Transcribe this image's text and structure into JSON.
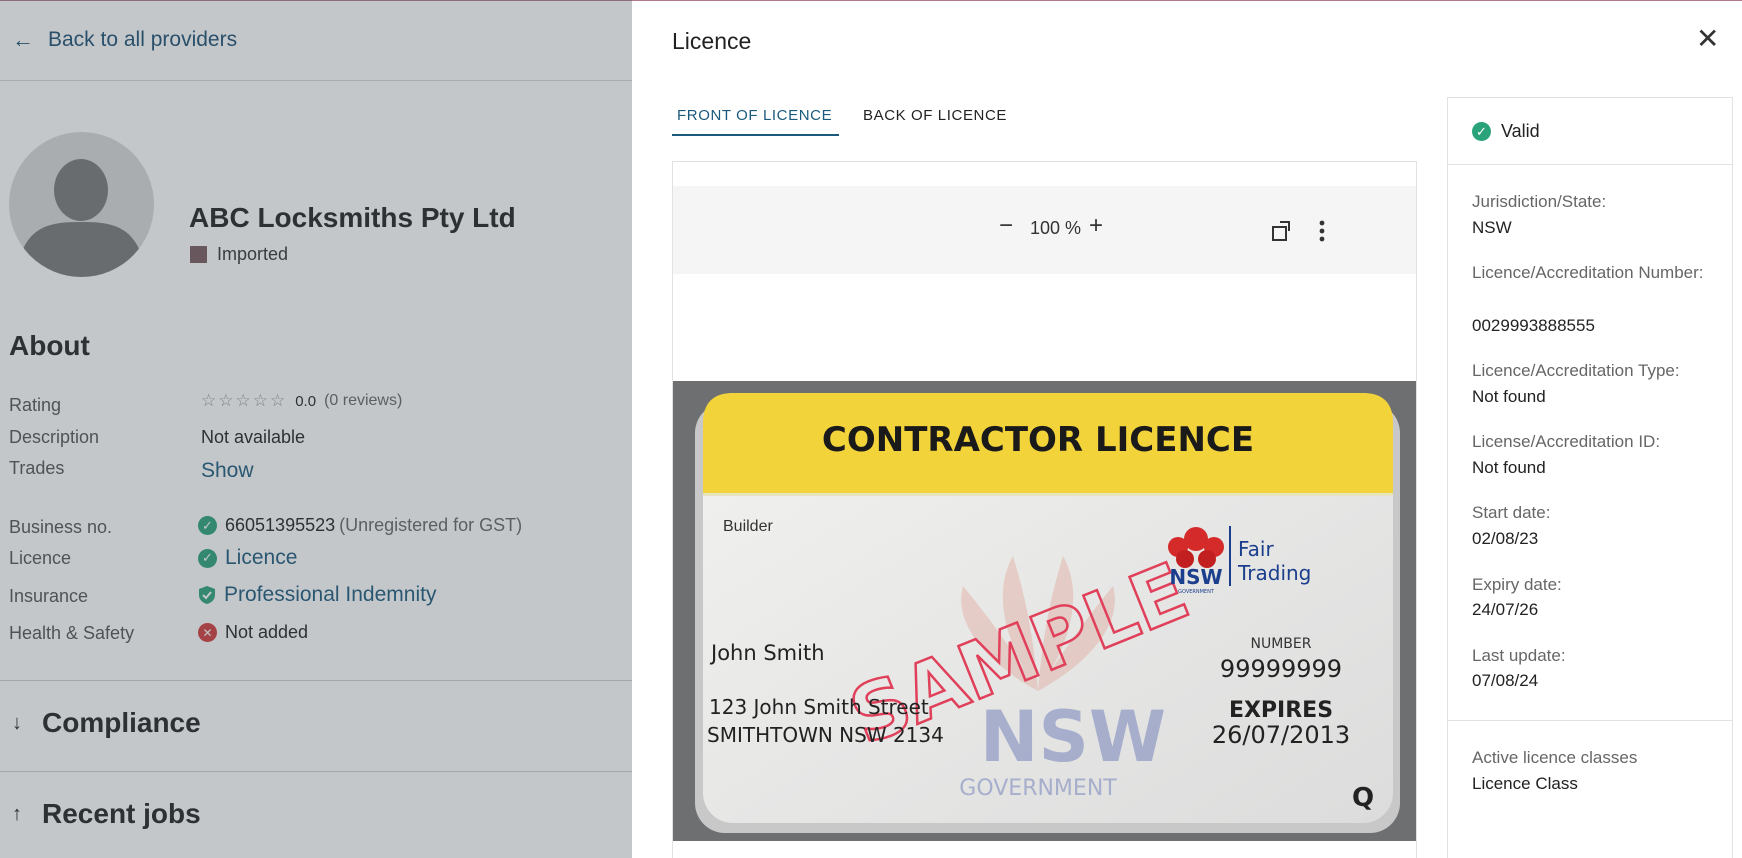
{
  "background": {
    "back_link": "Back to all providers",
    "provider_name": "ABC Locksmiths Pty Ltd",
    "status": "Imported",
    "about_title": "About",
    "rows": {
      "rating_label": "Rating",
      "rating_value": "0.0",
      "rating_reviews": "(0 reviews)",
      "rating_stars": 0,
      "description_label": "Description",
      "description_value": "Not available",
      "trades_label": "Trades",
      "trades_value": "Show",
      "business_label": "Business no.",
      "business_value": "66051395523",
      "business_note": "(Unregistered for GST)",
      "licence_label": "Licence",
      "licence_value": "Licence",
      "insurance_label": "Insurance",
      "insurance_value": "Professional Indemnity",
      "hs_label": "Health & Safety",
      "hs_value": "Not added"
    },
    "sections": {
      "compliance": "Compliance",
      "recent_jobs": "Recent jobs"
    }
  },
  "drawer": {
    "title": "Licence",
    "tabs": [
      {
        "label": "FRONT OF LICENCE",
        "active": true
      },
      {
        "label": "BACK OF LICENCE",
        "active": false
      }
    ],
    "viewer": {
      "zoom": "100 %",
      "image": {
        "header": "CONTRACTOR LICENCE",
        "class": "Builder",
        "name": "John Smith",
        "address1": "123 John Smith Street",
        "address2": "SMITHTOWN NSW 2134",
        "number_label": "NUMBER",
        "number": "99999999",
        "expires_label": "EXPIRES",
        "expires": "26/07/2013",
        "stamp": "SAMPLE",
        "nsw_big": "NSW",
        "gov_big": "GOVERNMENT",
        "logo_nsw": "NSW",
        "logo_gov": "GOVERNMENT",
        "logo_text1": "Fair",
        "logo_text2": "Trading",
        "corner": "Q"
      }
    },
    "panel": {
      "status": "Valid",
      "fields": [
        {
          "label": "Jurisdiction/State:",
          "value": "NSW"
        },
        {
          "label": "Licence/Accreditation Number:",
          "value": "0029993888555"
        },
        {
          "label": "Licence/Accreditation Type:",
          "value": "Not found"
        },
        {
          "label": "License/Accreditation ID:",
          "value": "Not found"
        },
        {
          "label": "Start date:",
          "value": "02/08/23"
        },
        {
          "label": "Expiry date:",
          "value": "24/07/26"
        },
        {
          "label": "Last update:",
          "value": "07/08/24"
        }
      ],
      "classes_label": "Active licence classes",
      "classes_value": "Licence Class"
    }
  },
  "colors": {
    "link": "#1b5a7c",
    "valid_green": "#2aa37a",
    "error_red": "#d23b3b",
    "licence_yellow": "#f3d33a"
  }
}
